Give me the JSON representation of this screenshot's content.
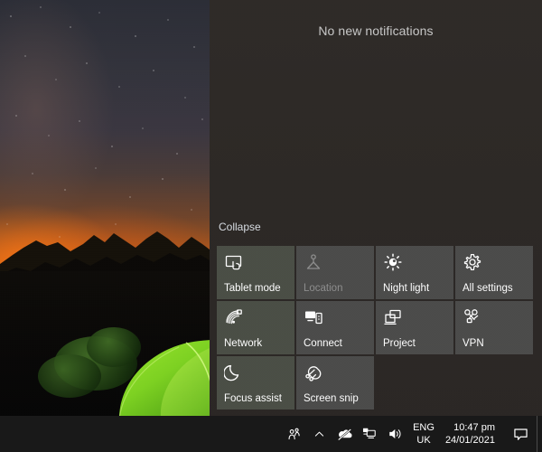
{
  "desktop": {
    "wallpaper_alt": "Green glowing tent under starry night sky with orange sunset glow over mountain silhouettes",
    "colors": {
      "sky_top": "#2b2d36",
      "horizon_glow": "#c25d14",
      "tent_green": "#7ed321",
      "ground": "#070605"
    }
  },
  "action_center": {
    "empty_message": "No new notifications",
    "collapse_label": "Collapse",
    "panel_color": "#2c2825",
    "tiles": [
      {
        "label": "Tablet mode",
        "icon": "tablet-mode-icon",
        "state": "enabled",
        "style": "a"
      },
      {
        "label": "Location",
        "icon": "location-icon",
        "state": "disabled",
        "style": "b"
      },
      {
        "label": "Night light",
        "icon": "night-light-icon",
        "state": "enabled",
        "style": "b"
      },
      {
        "label": "All settings",
        "icon": "settings-gear-icon",
        "state": "enabled",
        "style": "b"
      },
      {
        "label": "Network",
        "icon": "wifi-icon",
        "state": "enabled",
        "style": "a"
      },
      {
        "label": "Connect",
        "icon": "connect-icon",
        "state": "enabled",
        "style": "b"
      },
      {
        "label": "Project",
        "icon": "project-icon",
        "state": "enabled",
        "style": "b"
      },
      {
        "label": "VPN",
        "icon": "vpn-icon",
        "state": "enabled",
        "style": "b"
      },
      {
        "label": "Focus assist",
        "icon": "moon-icon",
        "state": "enabled",
        "style": "a"
      },
      {
        "label": "Screen snip",
        "icon": "screen-snip-icon",
        "state": "enabled",
        "style": "b"
      }
    ]
  },
  "taskbar": {
    "tray_icons": [
      {
        "name": "people-icon",
        "glyph": "people"
      },
      {
        "name": "show-hidden-icons-icon",
        "glyph": "chevron-up"
      },
      {
        "name": "onedrive-offline-icon",
        "glyph": "cloud-slash"
      },
      {
        "name": "network-icon",
        "glyph": "monitor"
      },
      {
        "name": "volume-icon",
        "glyph": "speaker"
      }
    ],
    "language": {
      "line1": "ENG",
      "line2": "UK"
    },
    "clock": {
      "time": "10:47 pm",
      "date": "24/01/2021"
    },
    "action_center_button": "action-center-icon",
    "background": "#191919"
  }
}
